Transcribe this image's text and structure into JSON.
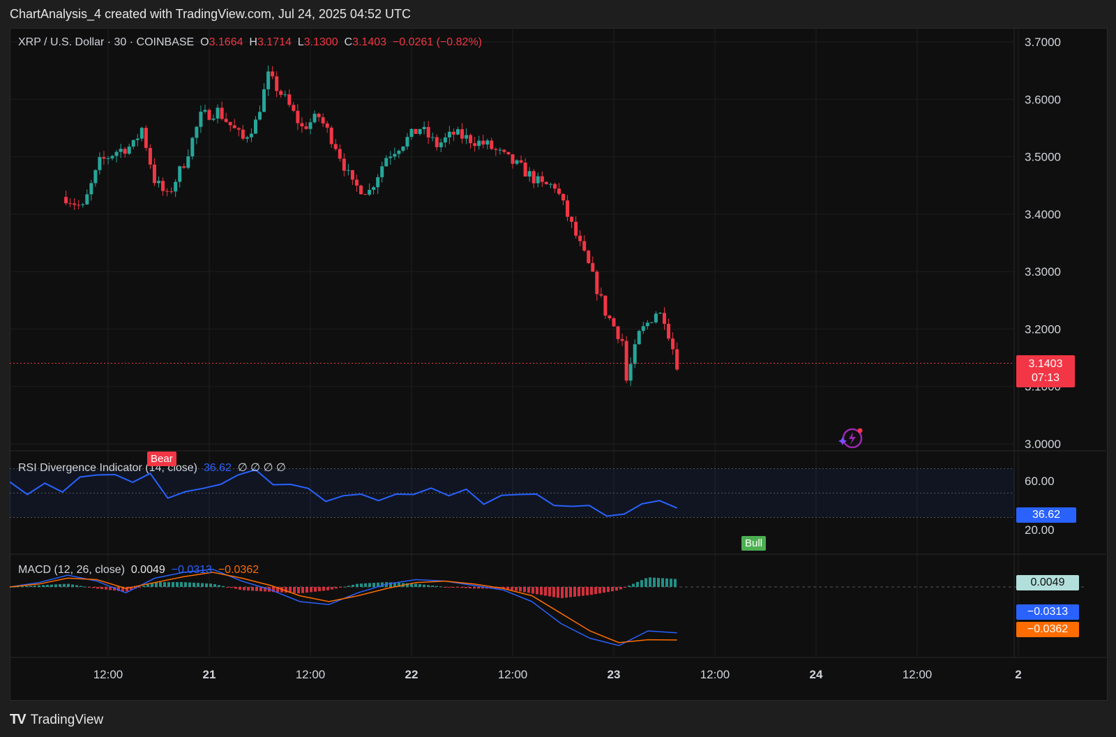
{
  "header": {
    "text": "ChartAnalysis_4 created with TradingView.com, Jul 24, 2025 04:52 UTC"
  },
  "brand": {
    "logo": "TV",
    "name": "TradingView"
  },
  "legend": {
    "symbol": "XRP / U.S. Dollar · 30 · COINBASE",
    "o_label": "O",
    "o": "3.1664",
    "h_label": "H",
    "h": "3.1714",
    "l_label": "L",
    "l": "3.1300",
    "c_label": "C",
    "c": "3.1403",
    "change": "−0.0261 (−0.82%)"
  },
  "price_tag": {
    "value": "3.1403",
    "countdown": "07:13"
  },
  "rsi": {
    "label": "RSI Divergence Indicator (14, close)",
    "value": "36.62",
    "flags": "∅  ∅  ∅  ∅",
    "axis_ticks": [
      "60.00",
      "20.00"
    ],
    "bear_label": "Bear",
    "bull_label": "Bull"
  },
  "macd": {
    "label": "MACD (12, 26, close)",
    "hist": "0.0049",
    "macd": "−0.0313",
    "signal": "−0.0362"
  },
  "colors": {
    "up": "#26a69a",
    "down": "#f23645",
    "rsi_line": "#2962ff",
    "macd_line": "#2962ff",
    "signal_line": "#ff6d00",
    "bull": "#4caf50"
  },
  "chart_data": {
    "type": "candlestick",
    "title": "XRP / U.S. Dollar · 30 · COINBASE",
    "price_axis": [
      "3.7000",
      "3.6000",
      "3.5000",
      "3.4000",
      "3.3000",
      "3.2000",
      "3.1000",
      "3.0000"
    ],
    "ylim": [
      3.0,
      3.7
    ],
    "time_axis": [
      "12:00",
      "21",
      "12:00",
      "22",
      "12:00",
      "23",
      "12:00",
      "24",
      "12:00",
      "2"
    ],
    "close_path": [
      {
        "t": "Jul 20 07:00",
        "close": 3.43
      },
      {
        "t": "Jul 20 09:00",
        "close": 3.41
      },
      {
        "t": "Jul 20 11:00",
        "close": 3.49
      },
      {
        "t": "Jul 20 13:00",
        "close": 3.51
      },
      {
        "t": "Jul 20 15:00",
        "close": 3.52
      },
      {
        "t": "Jul 20 16:00",
        "close": 3.55
      },
      {
        "t": "Jul 20 17:30",
        "close": 3.46
      },
      {
        "t": "Jul 20 19:00",
        "close": 3.43
      },
      {
        "t": "Jul 20 21:00",
        "close": 3.49
      },
      {
        "t": "Jul 20 23:00",
        "close": 3.57
      },
      {
        "t": "Jul 21 01:00",
        "close": 3.58
      },
      {
        "t": "Jul 21 04:00",
        "close": 3.53
      },
      {
        "t": "Jul 21 05:30",
        "close": 3.56
      },
      {
        "t": "Jul 21 07:00",
        "close": 3.64
      },
      {
        "t": "Jul 21 09:00",
        "close": 3.6
      },
      {
        "t": "Jul 21 11:00",
        "close": 3.55
      },
      {
        "t": "Jul 21 13:00",
        "close": 3.57
      },
      {
        "t": "Jul 21 15:00",
        "close": 3.52
      },
      {
        "t": "Jul 21 17:00",
        "close": 3.45
      },
      {
        "t": "Jul 21 19:00",
        "close": 3.44
      },
      {
        "t": "Jul 21 21:00",
        "close": 3.5
      },
      {
        "t": "Jul 22 01:00",
        "close": 3.55
      },
      {
        "t": "Jul 22 03:00",
        "close": 3.52
      },
      {
        "t": "Jul 22 05:00",
        "close": 3.54
      },
      {
        "t": "Jul 22 09:00",
        "close": 3.52
      },
      {
        "t": "Jul 22 13:00",
        "close": 3.48
      },
      {
        "t": "Jul 22 15:30",
        "close": 3.45
      },
      {
        "t": "Jul 22 17:00",
        "close": 3.45
      },
      {
        "t": "Jul 22 19:00",
        "close": 3.38
      },
      {
        "t": "Jul 22 21:00",
        "close": 3.31
      },
      {
        "t": "Jul 22 23:00",
        "close": 3.23
      },
      {
        "t": "Jul 23 01:00",
        "close": 3.18
      },
      {
        "t": "Jul 23 01:30",
        "close": 3.11
      },
      {
        "t": "Jul 23 03:00",
        "close": 3.19
      },
      {
        "t": "Jul 23 05:00",
        "close": 3.23
      },
      {
        "t": "Jul 23 06:00",
        "close": 3.22
      },
      {
        "t": "Jul 23 07:30",
        "close": 3.1403
      }
    ],
    "rsi": {
      "overbought": 70,
      "oversold": 30,
      "mid": 50,
      "path": [
        58,
        50,
        57,
        52,
        62,
        66,
        64,
        60,
        65,
        47,
        50,
        55,
        56,
        66,
        68,
        58,
        56,
        55,
        42,
        49,
        48,
        45,
        48,
        50,
        53,
        49,
        52,
        42,
        47,
        50,
        48,
        41,
        38,
        41,
        30,
        34,
        40,
        45,
        36.62
      ]
    },
    "macd": {
      "hist_last": 0.0049,
      "macd_last": -0.0313,
      "signal_last": -0.0362,
      "macd_path": [
        0.0,
        0.003,
        0.008,
        0.004,
        -0.004,
        0.006,
        0.01,
        0.012,
        0.004,
        -0.002,
        -0.01,
        -0.012,
        -0.004,
        0.002,
        0.005,
        0.004,
        0.001,
        -0.002,
        -0.01,
        -0.025,
        -0.035,
        -0.04,
        -0.03,
        -0.0313
      ],
      "signal_path": [
        0.0,
        0.002,
        0.006,
        0.005,
        -0.001,
        0.003,
        0.007,
        0.01,
        0.006,
        0.001,
        -0.006,
        -0.01,
        -0.006,
        -0.001,
        0.003,
        0.004,
        0.002,
        -0.001,
        -0.006,
        -0.018,
        -0.03,
        -0.038,
        -0.036,
        -0.0362
      ]
    }
  }
}
